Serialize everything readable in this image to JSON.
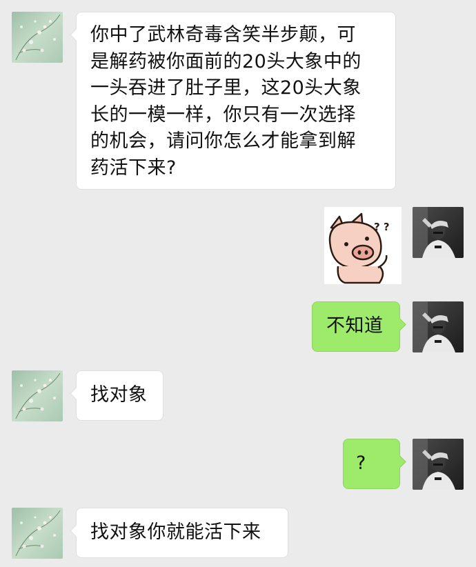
{
  "colors": {
    "background": "#ebebeb",
    "left_bubble": "#ffffff",
    "right_bubble": "#9eea6a"
  },
  "icons": {
    "other_avatar": "floral-avatar-icon",
    "self_avatar": "person-photo-avatar-icon",
    "sticker": "confused-pig-sticker-icon"
  },
  "messages": [
    {
      "side": "left",
      "type": "text",
      "text": "你中了武林奇毒含笑半步颠，可\n是解药被你面前的20头大象中的\n一头吞进了肚子里，这20头大象\n长的一模一样，你只有一次选择\n的机会，请问你怎么才能拿到解\n药活下来?"
    },
    {
      "side": "right",
      "type": "sticker",
      "sticker_text": "? ?"
    },
    {
      "side": "right",
      "type": "text",
      "text": "不知道"
    },
    {
      "side": "left",
      "type": "text",
      "text": "找对象"
    },
    {
      "side": "right",
      "type": "text",
      "text": "?"
    },
    {
      "side": "left",
      "type": "text",
      "text": "找对象你就能活下来"
    }
  ]
}
